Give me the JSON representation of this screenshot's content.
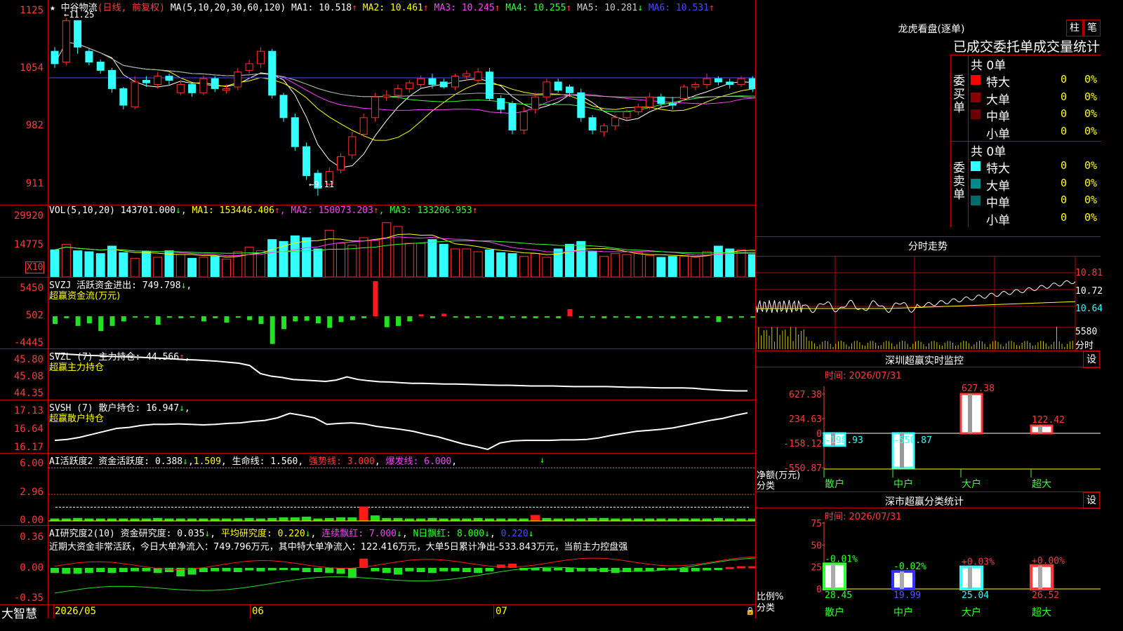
{
  "stock": {
    "name": "中谷物流",
    "period_label": "(日线, 前复权)",
    "high_mark": "11.25",
    "low_mark": "9.11"
  },
  "ma_line": {
    "label": "MA(5,10,20,30,60,120)",
    "items": [
      {
        "name": "MA1:",
        "value": "10.518",
        "arrow": "↑",
        "color": "#ffffff"
      },
      {
        "name": "MA2:",
        "value": "10.461",
        "arrow": "↑",
        "color": "#ffff00"
      },
      {
        "name": "MA3:",
        "value": "10.245",
        "arrow": "↑",
        "color": "#ff40ff"
      },
      {
        "name": "MA4:",
        "value": "10.255",
        "arrow": "↑",
        "color": "#33ff33"
      },
      {
        "name": "MA5:",
        "value": "10.281",
        "arrow": "↓",
        "color": "#cccccc"
      },
      {
        "name": "MA6:",
        "value": "10.531",
        "arrow": "↑",
        "color": "#4a4aff"
      }
    ]
  },
  "price_axis": [
    "1125",
    "1054",
    "982",
    "911"
  ],
  "vol": {
    "label": "VOL(5,10,20)",
    "value": "143701.000",
    "arrow": "↓",
    "items": [
      {
        "name": "MA1:",
        "value": "153446.406",
        "arrow": "↑",
        "color": "#ffff00"
      },
      {
        "name": "MA2:",
        "value": "150073.203",
        "arrow": "↑",
        "color": "#ff40ff"
      },
      {
        "name": "MA3:",
        "value": "133206.953",
        "arrow": "↑",
        "color": "#33ff33"
      }
    ],
    "axis": [
      "29920",
      "14775"
    ],
    "unit": "X10"
  },
  "svzj": {
    "label": "SVZJ  活跃资金进出:",
    "value": "749.798",
    "arrow": "↓",
    "sub": "超赢资金流(万元)",
    "axis": [
      "5450",
      "502",
      "-4445"
    ]
  },
  "svzl": {
    "label": "SVZL (7) 主力持仓:",
    "value": "44.566",
    "arrow": "↑",
    "sub": "超赢主力持仓",
    "axis": [
      "45.80",
      "45.08",
      "44.35"
    ]
  },
  "svsh": {
    "label": "SVSH (7) 散户持仓:",
    "value": "16.947",
    "arrow": "↓",
    "sub": "超赢散户持仓",
    "axis": [
      "17.13",
      "16.64",
      "16.17"
    ]
  },
  "ai_active": {
    "label": "AI活跃度2 资金活跃度:",
    "v1": "0.388",
    "v2": "1.509",
    "life_label": "生命线:",
    "life": "1.560",
    "strong_label": "强势线:",
    "strong": "3.000",
    "burst_label": "爆发线:",
    "burst": "6.000",
    "axis": [
      "6.00",
      "2.96",
      "0.00"
    ]
  },
  "ai_research": {
    "label": "AI研究度2(10) 资金研究度:",
    "v1": "0.035",
    "avg_label": "平均研究度:",
    "avg": "0.220",
    "cont_label": "连续飘红:",
    "cont": "7.000",
    "n_label": "N日飘红:",
    "n": "8.000",
    "v5": "0.220",
    "comment": "近期大资金非常活跃，今日大单净流入：749.796万元，其中特大单净流入：122.416万元，大单5日累计净出-533.843万元，当前主力控盘强",
    "axis": [
      "0.36",
      "0.00",
      "-0.35"
    ]
  },
  "date_axis": {
    "brand": "大智慧",
    "labels": [
      "2026/05",
      "06",
      "07"
    ]
  },
  "dragon_tiger": {
    "title": "龙虎看盘(逐单)",
    "btn1": "柱",
    "btn2": "笔",
    "header": "已成交委托单成交量统计",
    "buy": {
      "side": "委买单",
      "total": "共 0单",
      "rows": [
        {
          "label": "特大",
          "count": "0",
          "pct": "0%",
          "color": "#ff0000"
        },
        {
          "label": "大单",
          "count": "0",
          "pct": "0%",
          "color": "#8b0000"
        },
        {
          "label": "中单",
          "count": "0",
          "pct": "0%",
          "color": "#6a0000"
        },
        {
          "label": "小单",
          "count": "0",
          "pct": "0%",
          "color": "#000000"
        }
      ]
    },
    "sell": {
      "side": "委卖单",
      "total": "共 0单",
      "rows": [
        {
          "label": "特大",
          "count": "0",
          "pct": "0%",
          "color": "#33ffff"
        },
        {
          "label": "大单",
          "count": "0",
          "pct": "0%",
          "color": "#008a8a"
        },
        {
          "label": "中单",
          "count": "0",
          "pct": "0%",
          "color": "#006a6a"
        },
        {
          "label": "小单",
          "count": "0",
          "pct": "0%",
          "color": "#000000"
        }
      ]
    }
  },
  "intraday": {
    "title": "分时走势",
    "axis": [
      "10.81",
      "10.72",
      "10.64"
    ],
    "vol_axis": "5580",
    "vol_label": "分时"
  },
  "monitor": {
    "title": "深圳超赢实时监控",
    "btn": "设",
    "time_label": "时间:",
    "time": "2026/07/31",
    "axis": [
      "627.38",
      "234.63",
      "0",
      "-158.12",
      "-550.87"
    ],
    "left_label1": "净额(万元)",
    "left_label2": "分类",
    "categories": [
      "散户",
      "中户",
      "大户",
      "超大"
    ],
    "values": [
      -198.93,
      -550.87,
      627.38,
      122.42
    ],
    "value_labels": [
      "-198.93",
      "-550.87",
      "627.38",
      "122.42"
    ]
  },
  "classify": {
    "title": "深市超赢分类统计",
    "btn": "设",
    "time_label": "时间:",
    "time": "2026/07/31",
    "axis": [
      "75",
      "50",
      "25",
      "0"
    ],
    "left_label1": "比例%",
    "left_label2": "分类",
    "categories": [
      "散户",
      "中户",
      "大户",
      "超大"
    ],
    "values": [
      28.45,
      19.99,
      25.04,
      26.52
    ],
    "value_labels": [
      "28.45",
      "19.99",
      "25.04",
      "26.52"
    ],
    "changes": [
      "-0.01%",
      "-0.02%",
      "+0.03%",
      "+0.00%"
    ]
  },
  "chart_data": [
    {
      "type": "candlestick",
      "title": "中谷物流 (日线, 前复权)",
      "ylim": [
        9.0,
        11.35
      ],
      "open": [
        10.85,
        10.72,
        11.22,
        10.85,
        10.72,
        10.62,
        10.4,
        10.18,
        10.5,
        10.45,
        10.55,
        10.35,
        10.45,
        10.35,
        10.52,
        10.38,
        10.42,
        10.62,
        10.7,
        10.85,
        10.32,
        10.05,
        9.7,
        9.38,
        9.25,
        9.42,
        9.6,
        9.85,
        10.05,
        10.3,
        10.32,
        10.4,
        10.45,
        10.52,
        10.48,
        10.42,
        10.55,
        10.5,
        10.6,
        10.28,
        10.22,
        9.9,
        10.15,
        10.3,
        10.48,
        10.42,
        10.35,
        10.05,
        9.88,
        9.95,
        10.05,
        10.12,
        10.18,
        10.3,
        10.22,
        10.28,
        10.42,
        10.45,
        10.52,
        10.48,
        10.45,
        10.52,
        10.38,
        10.45,
        10.55,
        10.6
      ],
      "close": [
        10.7,
        11.22,
        10.9,
        10.72,
        10.62,
        10.4,
        10.2,
        10.48,
        10.47,
        10.55,
        10.5,
        10.45,
        10.35,
        10.52,
        10.4,
        10.4,
        10.6,
        10.7,
        10.85,
        10.32,
        10.05,
        9.7,
        9.35,
        9.2,
        9.4,
        9.58,
        9.82,
        10.05,
        10.3,
        10.32,
        10.4,
        10.47,
        10.52,
        10.45,
        10.42,
        10.55,
        10.58,
        10.6,
        10.28,
        10.15,
        9.9,
        10.12,
        10.3,
        10.48,
        10.38,
        10.35,
        10.05,
        9.9,
        9.95,
        10.05,
        10.12,
        10.18,
        10.3,
        10.22,
        10.2,
        10.42,
        10.45,
        10.52,
        10.48,
        10.45,
        10.52,
        10.4,
        10.45,
        10.55,
        10.6,
        10.72
      ],
      "high": [
        10.9,
        11.25,
        11.22,
        10.88,
        10.75,
        10.65,
        10.42,
        10.55,
        10.55,
        10.6,
        10.58,
        10.5,
        10.48,
        10.56,
        10.55,
        10.45,
        10.65,
        10.75,
        10.9,
        10.88,
        10.35,
        10.1,
        9.75,
        9.42,
        9.45,
        9.62,
        9.88,
        10.1,
        10.35,
        10.38,
        10.45,
        10.5,
        10.56,
        10.58,
        10.52,
        10.58,
        10.62,
        10.65,
        10.65,
        10.32,
        10.25,
        10.18,
        10.35,
        10.52,
        10.52,
        10.45,
        10.4,
        10.08,
        9.98,
        10.08,
        10.15,
        10.22,
        10.35,
        10.34,
        10.3,
        10.45,
        10.48,
        10.58,
        10.55,
        10.52,
        10.55,
        10.55,
        10.5,
        10.6,
        10.64,
        10.75
      ],
      "low": [
        10.65,
        10.68,
        10.82,
        10.68,
        10.58,
        10.35,
        10.15,
        10.15,
        10.42,
        10.4,
        10.45,
        10.32,
        10.3,
        10.32,
        10.36,
        10.34,
        10.38,
        10.58,
        10.65,
        10.28,
        10.0,
        9.65,
        9.3,
        9.11,
        9.2,
        9.38,
        9.55,
        9.82,
        10.0,
        10.25,
        10.28,
        10.35,
        10.4,
        10.4,
        10.4,
        10.38,
        10.5,
        10.45,
        10.25,
        10.1,
        9.85,
        9.85,
        10.1,
        10.25,
        10.35,
        10.3,
        10.0,
        9.85,
        9.82,
        9.9,
        10.02,
        10.08,
        10.15,
        10.18,
        10.15,
        10.25,
        10.38,
        10.4,
        10.44,
        10.4,
        10.42,
        10.36,
        10.35,
        10.42,
        10.5,
        10.55
      ]
    },
    {
      "type": "bar",
      "title": "VOL(5,10,20)",
      "ylim": [
        0,
        33000
      ],
      "values": [
        14500,
        17500,
        14000,
        13500,
        12500,
        16500,
        13000,
        10000,
        13500,
        10500,
        14000,
        12000,
        10000,
        10500,
        11000,
        9500,
        13500,
        16000,
        14000,
        20000,
        19000,
        22000,
        21000,
        15000,
        25000,
        18000,
        17000,
        21000,
        19500,
        29000,
        27000,
        18000,
        18000,
        20000,
        17500,
        15000,
        15000,
        13500,
        14500,
        13000,
        12500,
        11000,
        12500,
        10500,
        15000,
        17500,
        19000,
        13500,
        11000,
        12500,
        12000,
        13000,
        11500,
        10500,
        11000,
        11000,
        10500,
        13500,
        16500,
        15000,
        14500,
        12000,
        11000,
        14000,
        12500,
        16000
      ]
    },
    {
      "type": "bar",
      "title": "SVZJ 活跃资金进出",
      "ylim": [
        -5000,
        6000
      ],
      "values": [
        -1200,
        -300,
        -1500,
        -1100,
        -2300,
        -1500,
        -800,
        -200,
        -100,
        -1300,
        -200,
        -300,
        -200,
        -800,
        -300,
        -1000,
        -200,
        -600,
        -1200,
        -4300,
        -2000,
        -800,
        -700,
        -1100,
        -1800,
        -900,
        -600,
        -300,
        5450,
        -1700,
        -1500,
        -800,
        300,
        -300,
        400,
        -200,
        -300,
        -200,
        -200,
        -400,
        -200,
        -300,
        -300,
        -200,
        -300,
        1100,
        -200,
        -100,
        -300,
        -200,
        -100,
        -300,
        -200,
        -100,
        -300,
        -200,
        -300,
        -100,
        -900,
        -300,
        -100,
        -200,
        -100,
        -300,
        -2600,
        1200,
        700
      ]
    },
    {
      "type": "line",
      "title": "SVZL 主力持仓",
      "ylim": [
        44.3,
        45.85
      ],
      "values": [
        45.72,
        45.7,
        45.68,
        45.66,
        45.65,
        45.63,
        45.62,
        45.61,
        45.6,
        45.58,
        45.57,
        45.55,
        45.53,
        45.52,
        45.5,
        45.48,
        45.45,
        45.42,
        45.35,
        45.1,
        45.02,
        44.98,
        44.92,
        44.9,
        44.88,
        44.86,
        44.9,
        45.0,
        44.92,
        44.88,
        44.85,
        44.84,
        44.82,
        44.8,
        44.8,
        44.79,
        44.78,
        44.78,
        44.77,
        44.76,
        44.75,
        44.74,
        44.74,
        44.73,
        44.72,
        44.72,
        44.72,
        44.71,
        44.7,
        44.7,
        44.7,
        44.7,
        44.69,
        44.68,
        44.68,
        44.67,
        44.66,
        44.66,
        44.66,
        44.65,
        44.62,
        44.6,
        44.58,
        44.57,
        44.57
      ]
    },
    {
      "type": "line",
      "title": "SVSH 散户持仓",
      "ylim": [
        16.15,
        17.2
      ],
      "values": [
        16.4,
        16.42,
        16.46,
        16.52,
        16.58,
        16.64,
        16.66,
        16.7,
        16.72,
        16.72,
        16.73,
        16.72,
        16.71,
        16.72,
        16.74,
        16.75,
        16.78,
        16.8,
        16.85,
        16.94,
        16.9,
        16.85,
        16.72,
        16.74,
        16.75,
        16.73,
        16.68,
        16.65,
        16.62,
        16.58,
        16.52,
        16.47,
        16.4,
        16.33,
        16.28,
        16.22,
        16.35,
        16.39,
        16.4,
        16.4,
        16.4,
        16.41,
        16.41,
        16.42,
        16.45,
        16.5,
        16.54,
        16.58,
        16.6,
        16.62,
        16.65,
        16.7,
        16.75,
        16.8,
        16.84,
        16.9,
        16.95
      ]
    },
    {
      "type": "bar",
      "title": "AI活跃度2",
      "ylim": [
        0,
        6.5
      ],
      "values": [
        0.3,
        0.2,
        0.4,
        0.3,
        0.2,
        0.3,
        0.3,
        0.2,
        0.2,
        0.4,
        0.2,
        0.3,
        0.2,
        0.3,
        0.3,
        0.2,
        0.3,
        0.4,
        0.3,
        0.4,
        0.5,
        0.5,
        0.6,
        0.3,
        0.4,
        0.5,
        0.5,
        1.5,
        0.8,
        0.4,
        0.4,
        0.3,
        0.3,
        0.4,
        0.3,
        0.3,
        0.3,
        0.4,
        0.3,
        0.3,
        0.3,
        0.3,
        0.3,
        0.4,
        0.3,
        0.3,
        0.3,
        0.4,
        0.4,
        0.3,
        0.3,
        0.3,
        0.3,
        0.3,
        0.3,
        0.3,
        0.3,
        0.3,
        0.4,
        0.3,
        0.3,
        0.3,
        0.4,
        0.3,
        0.5,
        0.3
      ]
    },
    {
      "type": "bar",
      "title": "AI研究度2(10)",
      "ylim": [
        -0.4,
        0.4
      ],
      "values": [
        -0.06,
        -0.07,
        -0.07,
        -0.06,
        -0.05,
        -0.06,
        -0.05,
        -0.04,
        -0.04,
        -0.06,
        -0.05,
        -0.1,
        -0.08,
        -0.05,
        -0.04,
        -0.04,
        -0.05,
        -0.03,
        -0.04,
        -0.03,
        -0.02,
        -0.03,
        -0.05,
        -0.05,
        -0.06,
        -0.07,
        -0.12,
        0.11,
        -0.04,
        -0.06,
        -0.08,
        -0.04,
        -0.05,
        -0.06,
        -0.04,
        -0.04,
        -0.05,
        -0.06,
        -0.04,
        0.04,
        0.05,
        -0.03,
        -0.03,
        -0.04,
        -0.03,
        -0.05,
        -0.04,
        -0.04,
        -0.05,
        -0.06,
        -0.05,
        -0.04,
        -0.04,
        -0.03,
        -0.03,
        -0.05,
        -0.04,
        -0.03,
        -0.02,
        0.01,
        0.02,
        0.02,
        0.03,
        0.02,
        0.04,
        0.02
      ]
    }
  ]
}
